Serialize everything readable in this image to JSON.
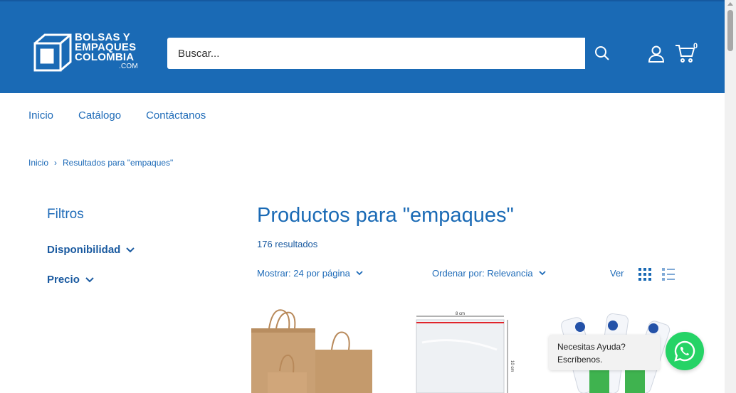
{
  "header": {
    "logo": {
      "line1": "BOLSAS Y",
      "line2": "EMPAQUES",
      "line3": "COLOMBIA",
      "line4": ".COM"
    },
    "search_placeholder": "Buscar...",
    "cart_count": "0"
  },
  "nav": {
    "items": [
      "Inicio",
      "Catálogo",
      "Contáctanos"
    ]
  },
  "breadcrumb": {
    "home": "Inicio",
    "separator": "›",
    "current": "Resultados para \"empaques\""
  },
  "filters": {
    "title": "Filtros",
    "items": [
      "Disponibilidad",
      "Precio"
    ]
  },
  "results": {
    "title": "Productos para \"empaques\"",
    "count": "176 resultados",
    "show_label": "Mostrar: 24 por página",
    "sort_label": "Ordenar por: Relevancia",
    "view_label": "Ver"
  },
  "products": [
    {
      "image": "kraft-paper-bags"
    },
    {
      "image": "zip-bag",
      "width_label": "8 cm",
      "height_label": "10 cm"
    },
    {
      "image": "yogurt-packs"
    }
  ],
  "chat": {
    "line1": "Necesitas Ayuda?",
    "line2": "Escríbenos."
  },
  "colors": {
    "header_bg": "#1a6ab5",
    "link": "#1e6bb8",
    "whatsapp": "#25d366"
  }
}
